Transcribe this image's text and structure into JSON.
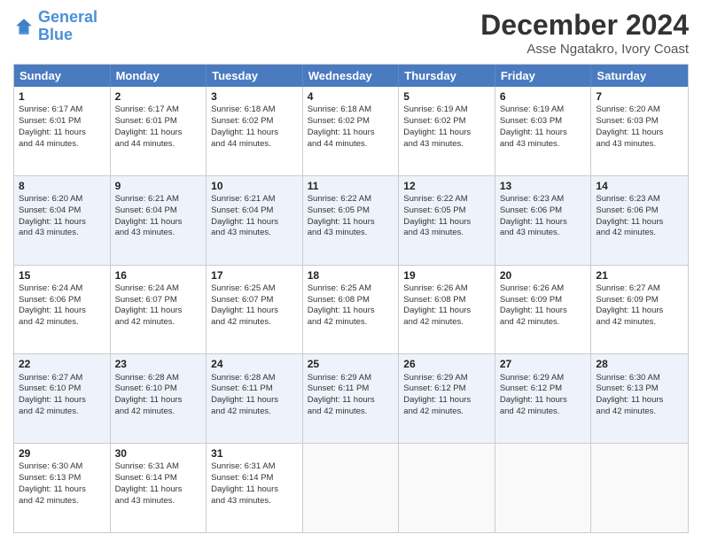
{
  "logo": {
    "line1": "General",
    "line2": "Blue"
  },
  "title": "December 2024",
  "subtitle": "Asse Ngatakro, Ivory Coast",
  "header_days": [
    "Sunday",
    "Monday",
    "Tuesday",
    "Wednesday",
    "Thursday",
    "Friday",
    "Saturday"
  ],
  "weeks": [
    [
      {
        "day": "1",
        "lines": [
          "Sunrise: 6:17 AM",
          "Sunset: 6:01 PM",
          "Daylight: 11 hours",
          "and 44 minutes."
        ]
      },
      {
        "day": "2",
        "lines": [
          "Sunrise: 6:17 AM",
          "Sunset: 6:01 PM",
          "Daylight: 11 hours",
          "and 44 minutes."
        ]
      },
      {
        "day": "3",
        "lines": [
          "Sunrise: 6:18 AM",
          "Sunset: 6:02 PM",
          "Daylight: 11 hours",
          "and 44 minutes."
        ]
      },
      {
        "day": "4",
        "lines": [
          "Sunrise: 6:18 AM",
          "Sunset: 6:02 PM",
          "Daylight: 11 hours",
          "and 44 minutes."
        ]
      },
      {
        "day": "5",
        "lines": [
          "Sunrise: 6:19 AM",
          "Sunset: 6:02 PM",
          "Daylight: 11 hours",
          "and 43 minutes."
        ]
      },
      {
        "day": "6",
        "lines": [
          "Sunrise: 6:19 AM",
          "Sunset: 6:03 PM",
          "Daylight: 11 hours",
          "and 43 minutes."
        ]
      },
      {
        "day": "7",
        "lines": [
          "Sunrise: 6:20 AM",
          "Sunset: 6:03 PM",
          "Daylight: 11 hours",
          "and 43 minutes."
        ]
      }
    ],
    [
      {
        "day": "8",
        "lines": [
          "Sunrise: 6:20 AM",
          "Sunset: 6:04 PM",
          "Daylight: 11 hours",
          "and 43 minutes."
        ]
      },
      {
        "day": "9",
        "lines": [
          "Sunrise: 6:21 AM",
          "Sunset: 6:04 PM",
          "Daylight: 11 hours",
          "and 43 minutes."
        ]
      },
      {
        "day": "10",
        "lines": [
          "Sunrise: 6:21 AM",
          "Sunset: 6:04 PM",
          "Daylight: 11 hours",
          "and 43 minutes."
        ]
      },
      {
        "day": "11",
        "lines": [
          "Sunrise: 6:22 AM",
          "Sunset: 6:05 PM",
          "Daylight: 11 hours",
          "and 43 minutes."
        ]
      },
      {
        "day": "12",
        "lines": [
          "Sunrise: 6:22 AM",
          "Sunset: 6:05 PM",
          "Daylight: 11 hours",
          "and 43 minutes."
        ]
      },
      {
        "day": "13",
        "lines": [
          "Sunrise: 6:23 AM",
          "Sunset: 6:06 PM",
          "Daylight: 11 hours",
          "and 43 minutes."
        ]
      },
      {
        "day": "14",
        "lines": [
          "Sunrise: 6:23 AM",
          "Sunset: 6:06 PM",
          "Daylight: 11 hours",
          "and 42 minutes."
        ]
      }
    ],
    [
      {
        "day": "15",
        "lines": [
          "Sunrise: 6:24 AM",
          "Sunset: 6:06 PM",
          "Daylight: 11 hours",
          "and 42 minutes."
        ]
      },
      {
        "day": "16",
        "lines": [
          "Sunrise: 6:24 AM",
          "Sunset: 6:07 PM",
          "Daylight: 11 hours",
          "and 42 minutes."
        ]
      },
      {
        "day": "17",
        "lines": [
          "Sunrise: 6:25 AM",
          "Sunset: 6:07 PM",
          "Daylight: 11 hours",
          "and 42 minutes."
        ]
      },
      {
        "day": "18",
        "lines": [
          "Sunrise: 6:25 AM",
          "Sunset: 6:08 PM",
          "Daylight: 11 hours",
          "and 42 minutes."
        ]
      },
      {
        "day": "19",
        "lines": [
          "Sunrise: 6:26 AM",
          "Sunset: 6:08 PM",
          "Daylight: 11 hours",
          "and 42 minutes."
        ]
      },
      {
        "day": "20",
        "lines": [
          "Sunrise: 6:26 AM",
          "Sunset: 6:09 PM",
          "Daylight: 11 hours",
          "and 42 minutes."
        ]
      },
      {
        "day": "21",
        "lines": [
          "Sunrise: 6:27 AM",
          "Sunset: 6:09 PM",
          "Daylight: 11 hours",
          "and 42 minutes."
        ]
      }
    ],
    [
      {
        "day": "22",
        "lines": [
          "Sunrise: 6:27 AM",
          "Sunset: 6:10 PM",
          "Daylight: 11 hours",
          "and 42 minutes."
        ]
      },
      {
        "day": "23",
        "lines": [
          "Sunrise: 6:28 AM",
          "Sunset: 6:10 PM",
          "Daylight: 11 hours",
          "and 42 minutes."
        ]
      },
      {
        "day": "24",
        "lines": [
          "Sunrise: 6:28 AM",
          "Sunset: 6:11 PM",
          "Daylight: 11 hours",
          "and 42 minutes."
        ]
      },
      {
        "day": "25",
        "lines": [
          "Sunrise: 6:29 AM",
          "Sunset: 6:11 PM",
          "Daylight: 11 hours",
          "and 42 minutes."
        ]
      },
      {
        "day": "26",
        "lines": [
          "Sunrise: 6:29 AM",
          "Sunset: 6:12 PM",
          "Daylight: 11 hours",
          "and 42 minutes."
        ]
      },
      {
        "day": "27",
        "lines": [
          "Sunrise: 6:29 AM",
          "Sunset: 6:12 PM",
          "Daylight: 11 hours",
          "and 42 minutes."
        ]
      },
      {
        "day": "28",
        "lines": [
          "Sunrise: 6:30 AM",
          "Sunset: 6:13 PM",
          "Daylight: 11 hours",
          "and 42 minutes."
        ]
      }
    ],
    [
      {
        "day": "29",
        "lines": [
          "Sunrise: 6:30 AM",
          "Sunset: 6:13 PM",
          "Daylight: 11 hours",
          "and 42 minutes."
        ]
      },
      {
        "day": "30",
        "lines": [
          "Sunrise: 6:31 AM",
          "Sunset: 6:14 PM",
          "Daylight: 11 hours",
          "and 43 minutes."
        ]
      },
      {
        "day": "31",
        "lines": [
          "Sunrise: 6:31 AM",
          "Sunset: 6:14 PM",
          "Daylight: 11 hours",
          "and 43 minutes."
        ]
      },
      {
        "day": "",
        "lines": []
      },
      {
        "day": "",
        "lines": []
      },
      {
        "day": "",
        "lines": []
      },
      {
        "day": "",
        "lines": []
      }
    ]
  ]
}
